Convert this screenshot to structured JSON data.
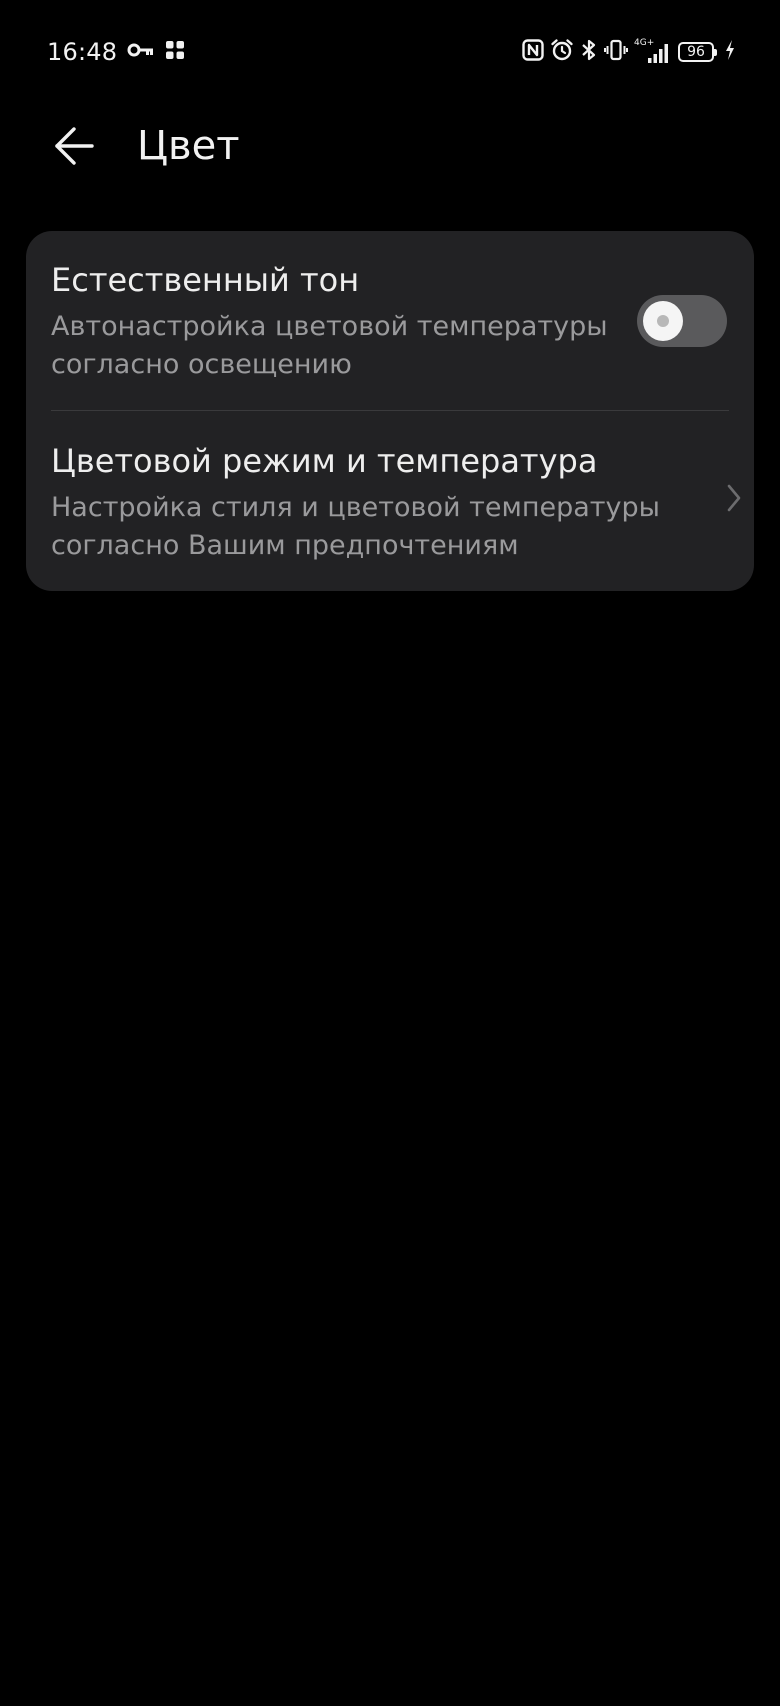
{
  "status_bar": {
    "time": "16:48",
    "battery": "96",
    "network": "4G+",
    "icons": [
      "vpn-key-icon",
      "apps-icon",
      "nfc-icon",
      "alarm-icon",
      "bluetooth-icon",
      "vibrate-icon",
      "signal-icon",
      "charging-icon"
    ]
  },
  "header": {
    "title": "Цвет",
    "back_icon": "back-arrow-icon"
  },
  "settings": {
    "items": [
      {
        "title": "Естественный тон",
        "subtitle": "Автонастройка цветовой температуры согласно освещению",
        "control": "toggle",
        "toggle_on": false
      },
      {
        "title": "Цветовой режим и температура",
        "subtitle": "Настройка стиля и цветовой температуры согласно Вашим предпочтениям",
        "control": "chevron-right-icon"
      }
    ]
  },
  "colors": {
    "background": "#000000",
    "card": "#222224",
    "primary_text": "#eeeeee",
    "secondary_text": "#9a9a9c",
    "toggle_track_off": "#5a5a5c"
  }
}
